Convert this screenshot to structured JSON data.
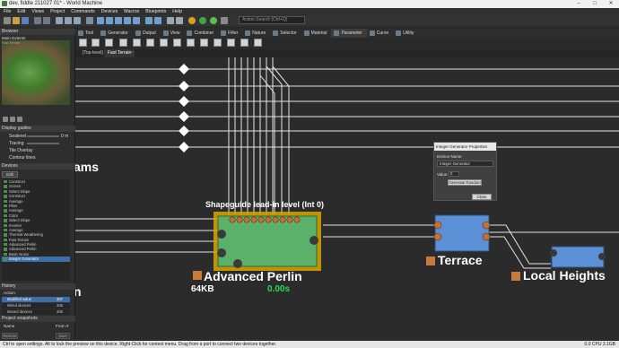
{
  "window": {
    "title": "dev, fiddle 211027 01* - World Machine"
  },
  "menu": [
    "File",
    "Edit",
    "Views",
    "Project",
    "Commands",
    "Devices",
    "Macros",
    "Blueprints",
    "Help"
  ],
  "search_placeholder": "Action Search (Ctrl+Q)",
  "browser": {
    "header": "Browser",
    "extents_label": "Main Extents",
    "extents_sub": "Fast Terrain"
  },
  "display_guides": {
    "header": "Display guides",
    "sealevel_label": "Sealevel",
    "sealevel_value": "0 m",
    "tracing_label": "Tracing",
    "tile_overlay": "Tile Overlay",
    "contour_lines": "Contour lines"
  },
  "devices": {
    "header": "Devices",
    "edit_label": "Edit",
    "items": [
      "Construct",
      "Screen",
      "Select Slope",
      "Construct",
      "Average",
      "Filter",
      "Average",
      "Color",
      "Select Slope",
      "Inverter",
      "Average",
      "Thermal Weathering",
      "Fast Terrain",
      "Advanced Perlin",
      "Advanced Perlin",
      "Basic Noise",
      "Integer Generator"
    ],
    "selected": "Integer Generator"
  },
  "history": {
    "header": "History",
    "col_action": "Action",
    "rows": [
      {
        "label": "Modified value",
        "value": "307"
      },
      {
        "label": "Wired devices",
        "value": "306"
      },
      {
        "label": "Moved devices",
        "value": "305"
      }
    ]
  },
  "snapshots": {
    "header": "Project snapshots",
    "col_name": "Name",
    "col_from": "From #",
    "restore": "Restore",
    "save": "Save"
  },
  "ribbon_tabs": [
    "Tool",
    "Generator",
    "Output",
    "View",
    "Combiner",
    "Filter",
    "Nature",
    "Selector",
    "Material",
    "Parameter",
    "Curve",
    "Utility"
  ],
  "canvas_tabs": [
    "[Top-level]",
    "Fast Terrain"
  ],
  "nodes": {
    "adv_perlin_name": "Advanced Perlin",
    "adv_perlin_size": "64KB",
    "adv_perlin_time": "0.00s",
    "adv_perlin_tooltip": "Shapeguide lead-in level (Int 0)",
    "terrace_name": "Terrace",
    "local_heights_name": "Local Heights",
    "partial_left_top": "ams",
    "partial_left_bottom": "n"
  },
  "dialog": {
    "title": "Integer Generator Properties",
    "device_name_label": "Device Name",
    "device_name_value": "Integer Generator",
    "value_label": "Value",
    "value": "0",
    "generate_random": "Generate Random",
    "close": "Close"
  },
  "status": {
    "hint": "Ctrl to open settings. Alt to lock the preview on this device. Right-Click for context menu. Drag from a port to connect two devices together.",
    "right": "0.0 CPU 3.1GB"
  },
  "colors": {
    "node_green": "#5bb06a",
    "node_blue": "#5b8fd6",
    "node_highlight": "#e8b80c",
    "port_orange": "#c87a3a",
    "time_green": "#22dd55"
  }
}
